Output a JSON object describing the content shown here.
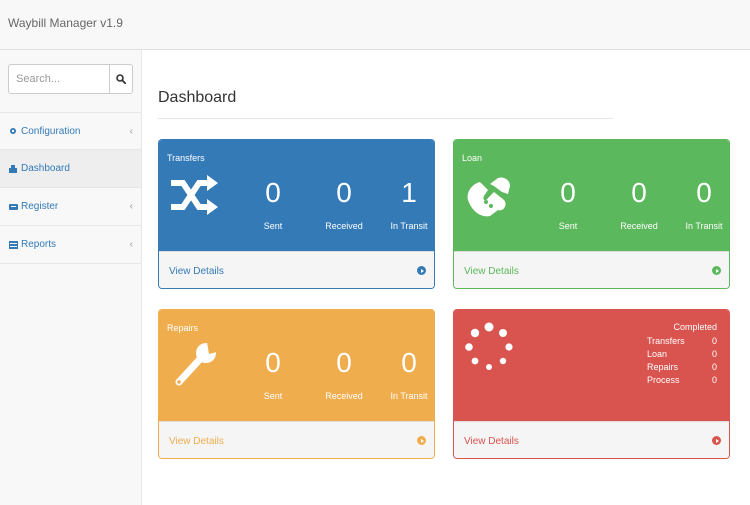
{
  "app": {
    "title": "Waybill Manager v1.9"
  },
  "search": {
    "placeholder": "Search..."
  },
  "sidebar": {
    "items": [
      {
        "label": "Configuration",
        "icon": "gear-icon"
      },
      {
        "label": "Dashboard",
        "icon": "dashboard-icon"
      },
      {
        "label": "Register",
        "icon": "register-icon"
      },
      {
        "label": "Reports",
        "icon": "report-icon"
      }
    ]
  },
  "page": {
    "title": "Dashboard"
  },
  "panels": {
    "transfers": {
      "label": "Transfers",
      "sent": "0",
      "received": "0",
      "in_transit": "1",
      "sent_label": "Sent",
      "received_label": "Received",
      "in_transit_label": "In Transit",
      "details": "View Details",
      "color": "#337ab7",
      "icon": "shuffle-icon"
    },
    "loan": {
      "label": "Loan",
      "sent": "0",
      "received": "0",
      "in_transit": "0",
      "sent_label": "Sent",
      "received_label": "Received",
      "in_transit_label": "In Transit",
      "details": "View Details",
      "color": "#5cb85c",
      "icon": "handshake-icon"
    },
    "repairs": {
      "label": "Repairs",
      "sent": "0",
      "received": "0",
      "in_transit": "0",
      "sent_label": "Sent",
      "received_label": "Received",
      "in_transit_label": "In Transit",
      "details": "View Details",
      "color": "#f0ad4e",
      "icon": "wrench-icon"
    },
    "completed": {
      "title": "Completed",
      "rows": [
        {
          "label": "Transfers",
          "value": "0"
        },
        {
          "label": "Loan",
          "value": "0"
        },
        {
          "label": "Repairs",
          "value": "0"
        },
        {
          "label": "Process",
          "value": "0"
        }
      ],
      "details": "View Details",
      "color": "#d9534f",
      "icon": "spinner-icon"
    }
  }
}
